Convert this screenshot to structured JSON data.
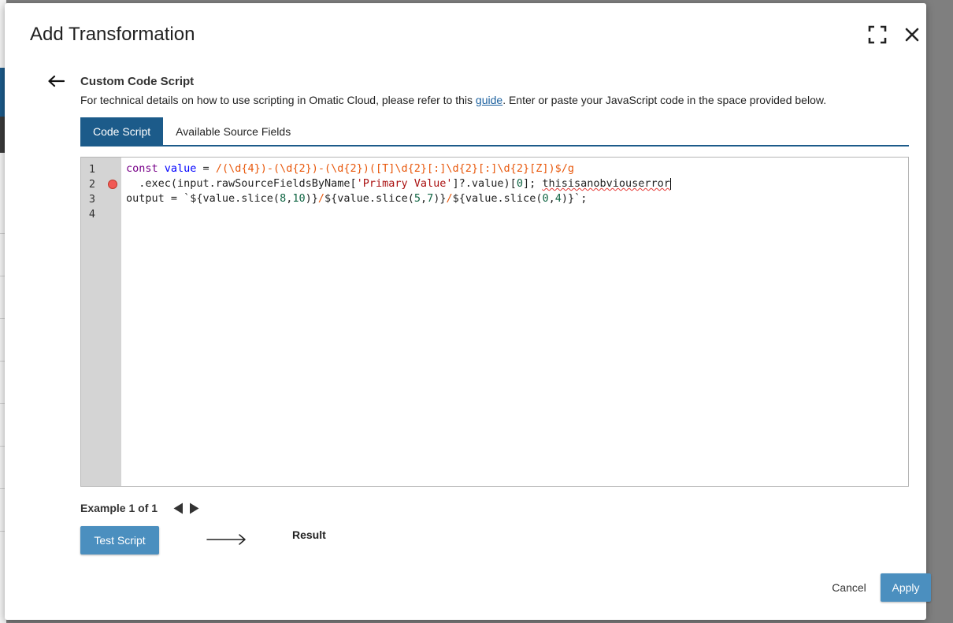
{
  "modal": {
    "title": "Add Transformation"
  },
  "section": {
    "title": "Custom Code Script",
    "desc_before": "For technical details on how to use scripting in Omatic Cloud, please refer to this ",
    "desc_link": "guide",
    "desc_after": ". Enter or paste your JavaScript code in the space provided below."
  },
  "tabs": [
    {
      "label": "Code Script",
      "active": true
    },
    {
      "label": "Available Source Fields",
      "active": false
    }
  ],
  "editor": {
    "line_numbers": [
      "1",
      "2",
      "3",
      "4"
    ],
    "error_line": 2,
    "lines": {
      "l1_kw": "const",
      "l1_def": "value",
      "l1_eq": " = ",
      "l1_re": "/(\\d{4})-(\\d{2})-(\\d{2})([T]\\d{2}[:]\\d{2}[:]\\d{2}[Z])$/g",
      "l2_a": "  .exec(input.rawSourceFieldsByName[",
      "l2_str": "'Primary Value'",
      "l2_b": "]?.value)[",
      "l2_num": "0",
      "l2_c": "]; ",
      "l2_err": "thisisanobviouserror",
      "l3_a": "output = `${value.slice(",
      "l3_n1": "8",
      "l3_c1": ",",
      "l3_n2": "10",
      "l3_b": ")}",
      "l3_s1": "/",
      "l3_c": "${value.slice(",
      "l3_n3": "5",
      "l3_c2": ",",
      "l3_n4": "7",
      "l3_d": ")}",
      "l3_s2": "/",
      "l3_e": "${value.slice(",
      "l3_n5": "0",
      "l3_c3": ",",
      "l3_n6": "4",
      "l3_f": ")}`;"
    }
  },
  "example": {
    "label": "Example 1 of 1"
  },
  "actions": {
    "test_label": "Test Script",
    "result_label": "Result",
    "cancel_label": "Cancel",
    "apply_label": "Apply"
  },
  "icons": {
    "expand": "fullscreen-icon",
    "close": "close-icon",
    "back": "arrow-left-icon",
    "prev": "triangle-left-icon",
    "next": "triangle-right-icon",
    "error": "error-dot-icon",
    "result_arrow": "long-arrow-right-icon"
  },
  "colors": {
    "primary": "#1c5b8a",
    "button": "#4b8fbf",
    "link": "#1a5f9e",
    "error": "#f15a56"
  }
}
